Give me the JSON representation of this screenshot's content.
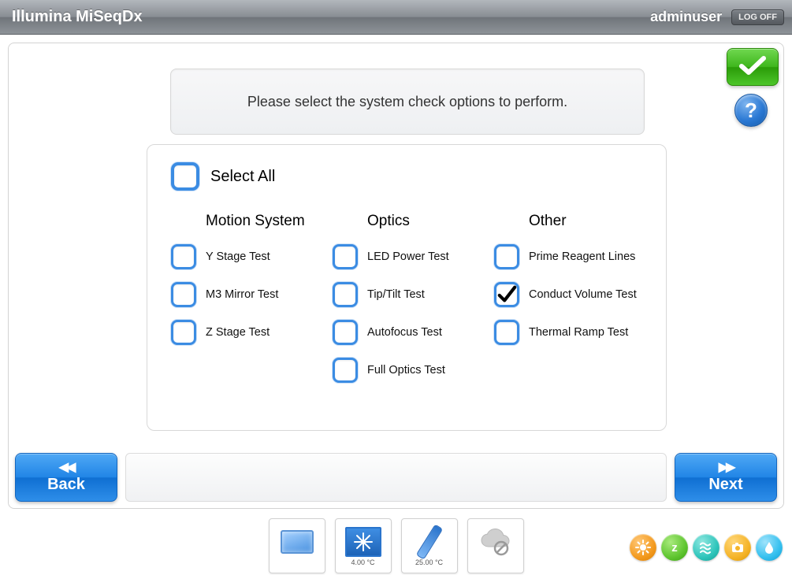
{
  "header": {
    "app_title": "Illumina MiSeqDx",
    "username": "adminuser",
    "logoff_label": "LOG OFF"
  },
  "instruction": "Please select the system check options to perform.",
  "icons": {
    "confirm": "checkmark-icon",
    "help": "help-icon",
    "help_glyph": "?"
  },
  "select_all": {
    "label": "Select All",
    "checked": false
  },
  "columns": [
    {
      "header": "Motion System",
      "items": [
        {
          "label": "Y Stage Test",
          "checked": false
        },
        {
          "label": "M3 Mirror Test",
          "checked": false
        },
        {
          "label": "Z Stage Test",
          "checked": false
        }
      ]
    },
    {
      "header": "Optics",
      "items": [
        {
          "label": "LED Power Test",
          "checked": false
        },
        {
          "label": "Tip/Tilt Test",
          "checked": false
        },
        {
          "label": "Autofocus Test",
          "checked": false
        },
        {
          "label": "Full Optics Test",
          "checked": false
        }
      ]
    },
    {
      "header": "Other",
      "items": [
        {
          "label": "Prime Reagent Lines",
          "checked": false
        },
        {
          "label": "Conduct Volume Test",
          "checked": true
        },
        {
          "label": "Thermal Ramp Test",
          "checked": false
        }
      ]
    }
  ],
  "nav": {
    "back_label": "Back",
    "next_label": "Next"
  },
  "status_tiles": {
    "screen": {
      "caption": ""
    },
    "chiller": {
      "caption": "4.00 °C"
    },
    "flowcell": {
      "caption": "25.00 °C"
    },
    "cloud": {
      "caption": ""
    }
  },
  "footer_icons": {
    "sun": "sun-icon",
    "sleep": "sleep-icon",
    "waves": "waves-icon",
    "camera": "camera-icon",
    "drop": "drop-icon"
  }
}
